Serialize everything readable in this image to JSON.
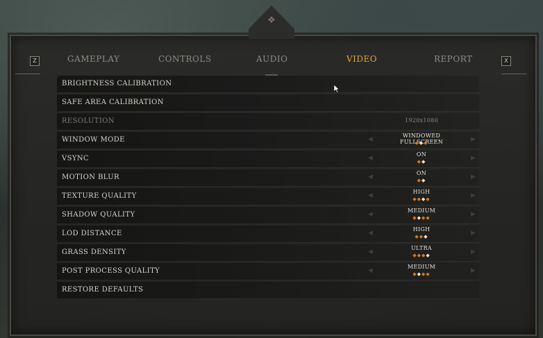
{
  "menu": {
    "left_key": "Z",
    "right_key": "X",
    "tabs": [
      {
        "label": "GAMEPLAY",
        "active": false
      },
      {
        "label": "CONTROLS",
        "active": false
      },
      {
        "label": "AUDIO",
        "active": false
      },
      {
        "label": "VIDEO",
        "active": true
      },
      {
        "label": "REPORT",
        "active": false
      }
    ]
  },
  "settings": [
    {
      "label": "BRIGHTNESS CALIBRATION",
      "value": "",
      "disabled": false
    },
    {
      "label": "SAFE AREA CALIBRATION",
      "value": "",
      "disabled": false
    },
    {
      "label": "RESOLUTION",
      "value": "1920x1080",
      "disabled": true
    },
    {
      "label": "WINDOW MODE",
      "value": "WINDOWED FULLSCREEN",
      "options": 3,
      "selected": 2
    },
    {
      "label": "VSYNC",
      "value": "ON",
      "options": 2,
      "selected": 2
    },
    {
      "label": "MOTION BLUR",
      "value": "ON",
      "options": 2,
      "selected": 2
    },
    {
      "label": "TEXTURE QUALITY",
      "value": "HIGH",
      "options": 4,
      "selected": 3
    },
    {
      "label": "SHADOW QUALITY",
      "value": "MEDIUM",
      "options": 4,
      "selected": 2
    },
    {
      "label": "LOD DISTANCE",
      "value": "HIGH",
      "options": 3,
      "selected": 3
    },
    {
      "label": "GRASS DENSITY",
      "value": "ULTRA",
      "options": 4,
      "selected": 4
    },
    {
      "label": "POST PROCESS QUALITY",
      "value": "MEDIUM",
      "options": 4,
      "selected": 2
    },
    {
      "label": "RESTORE DEFAULTS",
      "value": "",
      "disabled": false
    }
  ],
  "colors": {
    "accent": "#e8a33b",
    "option_dot": "#d07a24",
    "option_dot_selected": "#f3e3c2"
  }
}
